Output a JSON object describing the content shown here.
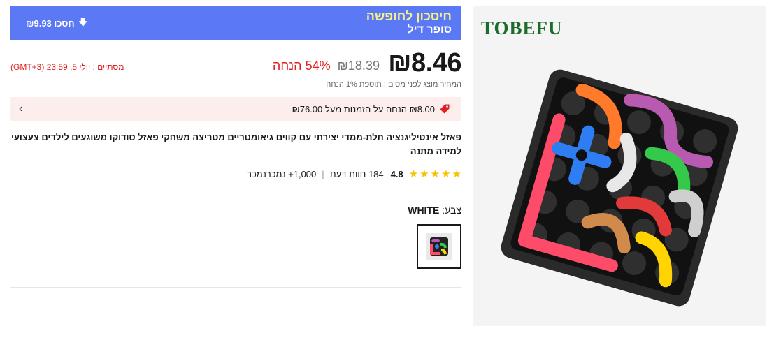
{
  "brand": "TOBEFU",
  "deal": {
    "title": "חיסכון לחופשה",
    "subtitle": "סופר דיל",
    "save_label": "₪9.93 חסכו"
  },
  "price": {
    "current": "₪8.46",
    "original": "₪18.39",
    "discount": "54% הנחה",
    "timer": "מסתיים : יולי 5, 23:59 (GMT+3)",
    "tax_note": "המחיר מוצג לפני מסים ; תוספת 1% הנחה"
  },
  "coupon": {
    "text": "₪8.00 הנחה על הזמנות מעל ₪76.00"
  },
  "product": {
    "title": "פאזל אינטיליגנציה תלת-ממדי יצירתי עם קווים גיאומטריים מטריצה משחקי פאזל סודוקו משוגעים לילדים צעצועי למידה מתנה"
  },
  "rating": {
    "value": "4.8",
    "stars": 5,
    "reviews": "184 חוות דעת",
    "sold": "1,000+ נמכרנמכר"
  },
  "color": {
    "label": "צבע: ",
    "value": "WHITE"
  },
  "colors": {
    "banner": "#5b78f5",
    "deal_title": "#f5ef8a",
    "sale_red": "#e02020",
    "coupon_bg": "#fdeeee",
    "star": "#f5c400",
    "brand_green": "#1b6b2b"
  },
  "icons": {
    "save": "arrow-down-icon",
    "coupon": "tag-icon",
    "chevron": "chevron-right-icon",
    "star": "star-icon"
  }
}
